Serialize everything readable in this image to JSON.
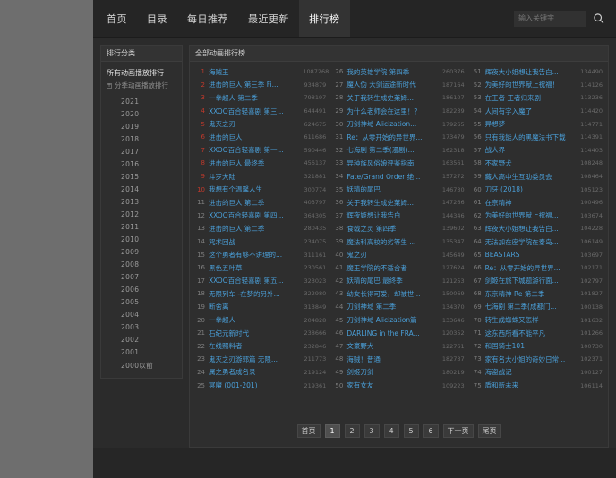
{
  "header": {
    "nav": [
      {
        "label": "首页",
        "active": false
      },
      {
        "label": "目录",
        "active": false
      },
      {
        "label": "每日推荐",
        "active": false
      },
      {
        "label": "最近更新",
        "active": false
      },
      {
        "label": "排行榜",
        "active": true
      }
    ],
    "search": {
      "placeholder": "输入关键字",
      "value": "",
      "icon": "search-icon"
    }
  },
  "sidebar": {
    "title": "排行分类",
    "all_label": "所有动画播放排行",
    "season_label": "分季动画播放排行",
    "expand_icon": "plus-icon",
    "years": [
      "2021",
      "2020",
      "2019",
      "2018",
      "2017",
      "2016",
      "2015",
      "2014",
      "2013",
      "2012",
      "2011",
      "2010",
      "2009",
      "2008",
      "2007",
      "2006",
      "2005",
      "2004",
      "2003",
      "2002",
      "2001",
      "2000以前"
    ]
  },
  "main": {
    "title": "全部动画排行榜",
    "columns": [
      {
        "rows": [
          {
            "rank": "1",
            "title": "海贼王",
            "count": "1087268"
          },
          {
            "rank": "2",
            "title": "进击的巨人 第三季 Fi...",
            "count": "934879"
          },
          {
            "rank": "3",
            "title": "一拳超人 第二季",
            "count": "798197"
          },
          {
            "rank": "4",
            "title": "XXOO百合轻喜剧 第三...",
            "count": "644491"
          },
          {
            "rank": "5",
            "title": "鬼灭之刃",
            "count": "624675"
          },
          {
            "rank": "6",
            "title": "进击的巨人",
            "count": "611686"
          },
          {
            "rank": "7",
            "title": "XXOO百合轻喜剧 第一...",
            "count": "590446"
          },
          {
            "rank": "8",
            "title": "进击的巨人 最终季",
            "count": "456137"
          },
          {
            "rank": "9",
            "title": "斗罗大陆",
            "count": "321881"
          },
          {
            "rank": "10",
            "title": "我想有个温馨人生",
            "count": "300774"
          },
          {
            "rank": "11",
            "title": "进击的巨人 第二季",
            "count": "403797"
          },
          {
            "rank": "12",
            "title": "XXOO百合轻喜剧 第四...",
            "count": "364305"
          },
          {
            "rank": "13",
            "title": "进击的巨人 第二季",
            "count": "280435"
          },
          {
            "rank": "14",
            "title": "咒术回战",
            "count": "234075"
          },
          {
            "rank": "15",
            "title": "这个勇者有够不讲理的...",
            "count": "311161"
          },
          {
            "rank": "16",
            "title": "黑色五叶草",
            "count": "230561"
          },
          {
            "rank": "17",
            "title": "XXOO百合轻喜剧 第五...",
            "count": "323023"
          },
          {
            "rank": "18",
            "title": "无限列车 -在梦的另外...",
            "count": "322980"
          },
          {
            "rank": "19",
            "title": "断舍离",
            "count": "313849"
          },
          {
            "rank": "20",
            "title": "一拳超人",
            "count": "204828"
          },
          {
            "rank": "21",
            "title": "石纪元新时代",
            "count": "238666"
          },
          {
            "rank": "22",
            "title": "在线照料者",
            "count": "232846"
          },
          {
            "rank": "23",
            "title": "鬼灭之刃游郭篇 无限...",
            "count": "211773"
          },
          {
            "rank": "24",
            "title": "属之勇者成名录",
            "count": "219124"
          },
          {
            "rank": "25",
            "title": "冥魔 (001-201)",
            "count": "219361"
          }
        ]
      },
      {
        "rows": [
          {
            "rank": "26",
            "title": "我的英雄学院 第四季",
            "count": "260376"
          },
          {
            "rank": "27",
            "title": "魔人伪 大剑运途新时代",
            "count": "187164"
          },
          {
            "rank": "28",
            "title": "关于我转生成史莱姆...",
            "count": "186107"
          },
          {
            "rank": "29",
            "title": "为什么老师会在这里！？",
            "count": "182239"
          },
          {
            "rank": "30",
            "title": "刀剑神域 Alicization...",
            "count": "179265"
          },
          {
            "rank": "31",
            "title": "Re：从零开始的异世界...",
            "count": "173479"
          },
          {
            "rank": "32",
            "title": "七海剧 第二季(漫剧)...",
            "count": "162318"
          },
          {
            "rank": "33",
            "title": "异种族风俗娘评鉴指南",
            "count": "163561"
          },
          {
            "rank": "34",
            "title": "Fate/Grand Order 绝...",
            "count": "157272"
          },
          {
            "rank": "35",
            "title": "妖精的尾巴",
            "count": "146730"
          },
          {
            "rank": "36",
            "title": "关于我转生成史莱姆...",
            "count": "147266"
          },
          {
            "rank": "37",
            "title": "辉夜姬想让我告白",
            "count": "144346"
          },
          {
            "rank": "38",
            "title": "食戟之灵 第四季",
            "count": "139602"
          },
          {
            "rank": "39",
            "title": "魔法科高校的劣等生 ...",
            "count": "135347"
          },
          {
            "rank": "40",
            "title": "鬼之刃",
            "count": "145649"
          },
          {
            "rank": "41",
            "title": "魔王学院的不适合者",
            "count": "127624"
          },
          {
            "rank": "42",
            "title": "妖精的尾巴 最终季",
            "count": "121253"
          },
          {
            "rank": "43",
            "title": "幼女长得可爱，却被世...",
            "count": "150069"
          },
          {
            "rank": "44",
            "title": "刀剑神域 第二季",
            "count": "134370"
          },
          {
            "rank": "45",
            "title": "刀剑神域 Alicization篇",
            "count": "133646"
          },
          {
            "rank": "46",
            "title": "DARLING in the FRA...",
            "count": "120352"
          },
          {
            "rank": "47",
            "title": "文豪野犬",
            "count": "122761"
          },
          {
            "rank": "48",
            "title": "海贼！普通",
            "count": "182737"
          },
          {
            "rank": "49",
            "title": "剑姬刀剑",
            "count": "180219"
          },
          {
            "rank": "50",
            "title": "家有女友",
            "count": "109223"
          }
        ]
      },
      {
        "rows": [
          {
            "rank": "51",
            "title": "辉夜大小姐想让我告白...",
            "count": "134490"
          },
          {
            "rank": "52",
            "title": "为美好的世界献上祝福！",
            "count": "114126"
          },
          {
            "rank": "53",
            "title": "在王者 王者归来剧",
            "count": "113236"
          },
          {
            "rank": "54",
            "title": "人间有字入魔了",
            "count": "114420"
          },
          {
            "rank": "55",
            "title": "异想梦",
            "count": "114771"
          },
          {
            "rank": "56",
            "title": "只有我能人的黑魔法书下载",
            "count": "114391"
          },
          {
            "rank": "57",
            "title": "战人界",
            "count": "114403"
          },
          {
            "rank": "58",
            "title": "不家野犬",
            "count": "108248"
          },
          {
            "rank": "59",
            "title": "藏人高中生互助委员会",
            "count": "108464"
          },
          {
            "rank": "60",
            "title": "刀牙 (2018)",
            "count": "105123"
          },
          {
            "rank": "61",
            "title": "在京精神",
            "count": "100496"
          },
          {
            "rank": "62",
            "title": "为美好的世界献上祝福...",
            "count": "103674"
          },
          {
            "rank": "63",
            "title": "辉夜大小姐想让我告白...",
            "count": "104228"
          },
          {
            "rank": "64",
            "title": "无法加在座学院在泰岛...",
            "count": "106149"
          },
          {
            "rank": "65",
            "title": "BEASTARS",
            "count": "103697"
          },
          {
            "rank": "66",
            "title": "Re：从零开始的异世界...",
            "count": "102171"
          },
          {
            "rank": "67",
            "title": "剑姬在旅下城题游行面...",
            "count": "102797"
          },
          {
            "rank": "68",
            "title": "东京精神 Re 第二季",
            "count": "101827"
          },
          {
            "rank": "69",
            "title": "七海剧 第二季(成都门...",
            "count": "100138"
          },
          {
            "rank": "70",
            "title": "转生成蜘蛛又怎样",
            "count": "101632"
          },
          {
            "rank": "71",
            "title": "这东西所看不能平凡",
            "count": "101266"
          },
          {
            "rank": "72",
            "title": "和国骑士101",
            "count": "100730"
          },
          {
            "rank": "73",
            "title": "家有名大小姐的奇妙日常...",
            "count": "102371"
          },
          {
            "rank": "74",
            "title": "海盗战记",
            "count": "100127"
          },
          {
            "rank": "75",
            "title": "盾和新未来",
            "count": "106114"
          }
        ]
      }
    ]
  },
  "pagination": [
    {
      "label": "首页",
      "active": false
    },
    {
      "label": "1",
      "active": true
    },
    {
      "label": "2",
      "active": false
    },
    {
      "label": "3",
      "active": false
    },
    {
      "label": "4",
      "active": false
    },
    {
      "label": "5",
      "active": false
    },
    {
      "label": "6",
      "active": false
    },
    {
      "label": "下一页",
      "active": false
    },
    {
      "label": "尾页",
      "active": false
    }
  ]
}
